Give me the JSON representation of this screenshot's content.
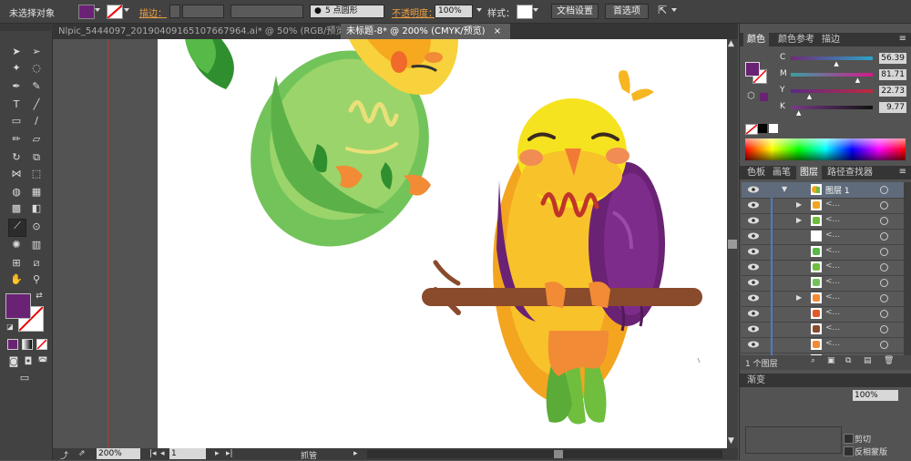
{
  "control_bar": {
    "selection_status": "未选择对象",
    "stroke_label": "描边：",
    "brush_label": "5 点圆形",
    "opacity_label": "不透明度：",
    "opacity_value": "100%",
    "style_label": "样式：",
    "document_setup": "文档设置",
    "preferences": "首选项"
  },
  "document_tabs": [
    {
      "label": "Nlpic_5444097_20190409165107667964.ai* @ 50% (RGB/预览)"
    },
    {
      "label": "未标题-8* @ 200% (CMYK/预览)"
    }
  ],
  "status_bar": {
    "zoom": "200%",
    "page": "1",
    "tool_name": "抓管"
  },
  "color_panel": {
    "tabs": [
      "颜色",
      "颜色参考",
      "描边"
    ],
    "channels": [
      {
        "name": "C",
        "value": "56.39",
        "fill": 0.56
      },
      {
        "name": "M",
        "value": "81.71",
        "fill": 0.82
      },
      {
        "name": "Y",
        "value": "22.73",
        "fill": 0.23
      },
      {
        "name": "K",
        "value": "9.77",
        "fill": 0.1
      }
    ]
  },
  "layers_panel": {
    "tabs": [
      "色板",
      "画笔",
      "图层",
      "路径查找器"
    ],
    "top_layer_name": "图层 1",
    "sublayer_name": "<...",
    "footer": "1 个图层"
  },
  "transparency_panel": {
    "tab_label": "渐变",
    "opacity_value": "100%",
    "clip_label": "剪切",
    "invert_label": "反相蒙版"
  },
  "colors": {
    "fill_purple": "#6a2274",
    "accent_orange": "#f08c3a"
  }
}
